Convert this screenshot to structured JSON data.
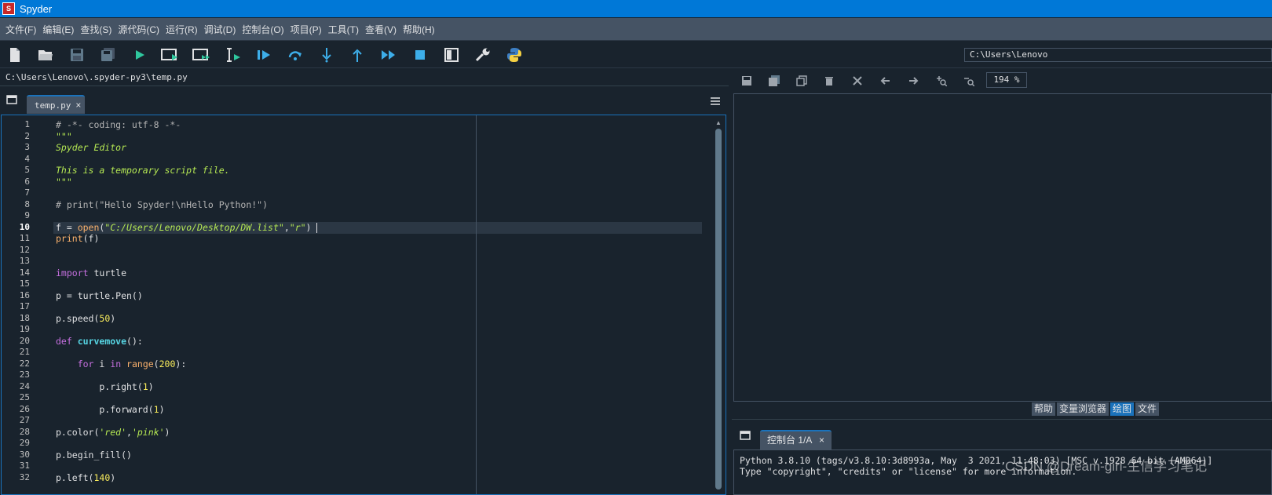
{
  "window": {
    "title": "Spyder",
    "app_icon_text": "S"
  },
  "menu": [
    "文件(F)",
    "编辑(E)",
    "查找(S)",
    "源代码(C)",
    "运行(R)",
    "调试(D)",
    "控制台(O)",
    "项目(P)",
    "工具(T)",
    "查看(V)",
    "帮助(H)"
  ],
  "toolbar": {
    "icons": [
      "new-file-icon",
      "open-file-icon",
      "save-icon",
      "save-all-icon",
      "run-icon",
      "run-cell-icon",
      "run-cell-advance-icon",
      "run-selection-icon",
      "debug-icon",
      "step-over-icon",
      "step-into-icon",
      "step-return-icon",
      "continue-icon",
      "stop-icon",
      "maximize-pane-icon",
      "preferences-icon",
      "pythonpath-icon"
    ],
    "cwd": "C:\\Users\\Lenovo"
  },
  "editor": {
    "file_path": "C:\\Users\\Lenovo\\.spyder-py3\\temp.py",
    "tab_label": "temp.py",
    "tab_close": "×",
    "current_line": 10,
    "line_numbers": [
      "1",
      "2",
      "3",
      "4",
      "5",
      "6",
      "7",
      "8",
      "9",
      "10",
      "11",
      "12",
      "13",
      "14",
      "15",
      "16",
      "17",
      "18",
      "19",
      "20",
      "21",
      "22",
      "23",
      "24",
      "25",
      "26",
      "27",
      "28",
      "29",
      "30",
      "31",
      "32"
    ],
    "lines": [
      "# -*- coding: utf-8 -*-",
      "\"\"\"",
      "Spyder Editor",
      "",
      "This is a temporary script file.",
      "\"\"\"",
      "",
      "# print(\"Hello Spyder!\\nHello Python!\")",
      "",
      "f = open(\"C:/Users/Lenovo/Desktop/DW.list\",\"r\")",
      "print(f)",
      "",
      "",
      "import turtle",
      "",
      "p = turtle.Pen()",
      "",
      "p.speed(50)",
      "",
      "def curvemove():",
      "",
      "    for i in range(200):",
      "",
      "        p.right(1)",
      "",
      "        p.forward(1)",
      "",
      "p.color('red','pink')",
      "",
      "p.begin_fill()",
      "",
      "p.left(140)"
    ]
  },
  "plots": {
    "toolbar_icons": [
      "save-plot-icon",
      "save-all-plots-icon",
      "copy-plot-icon",
      "remove-plot-icon",
      "remove-all-plots-icon",
      "previous-plot-icon",
      "next-plot-icon",
      "zoom-in-icon",
      "zoom-out-icon"
    ],
    "zoom": "194 %"
  },
  "pane_tabs": [
    "帮助",
    "变量浏览器",
    "绘图",
    "文件"
  ],
  "pane_tabs_selected": "绘图",
  "console": {
    "tab_label": "控制台 1/A",
    "tab_close": "×",
    "lines": [
      "Python 3.8.10 (tags/v3.8.10:3d8993a, May  3 2021, 11:48:03) [MSC v.1928 64 bit (AMD64)]",
      "Type \"copyright\", \"credits\" or \"license\" for more information."
    ]
  },
  "watermark": "CSDN @Dream-girl-生信学习笔记",
  "colors": {
    "accent": "#1a72bb",
    "titlebar": "#0078d7",
    "background": "#19232d",
    "panel": "#455364"
  }
}
